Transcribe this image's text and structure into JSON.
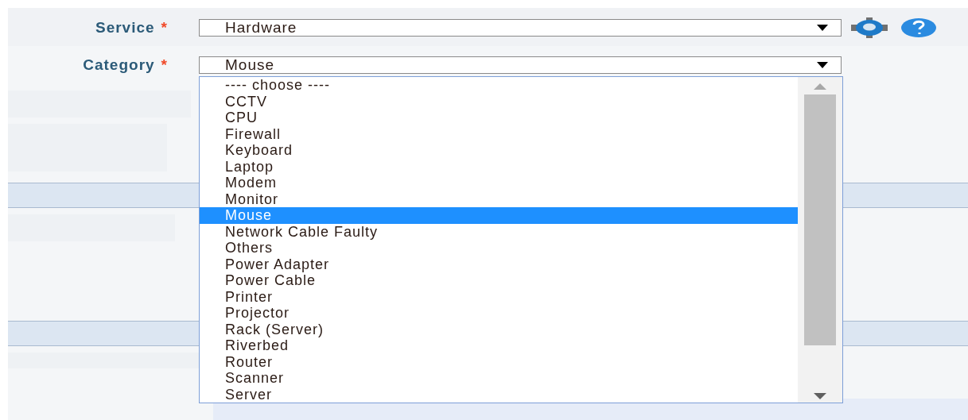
{
  "fields": [
    {
      "label": "Service",
      "required_mark": "*",
      "value": "Hardware"
    },
    {
      "label": "Category",
      "required_mark": "*",
      "value": "Mouse"
    }
  ],
  "dropdown": {
    "options": [
      {
        "label": "---- choose ----",
        "selected": false
      },
      {
        "label": "CCTV",
        "selected": false
      },
      {
        "label": "CPU",
        "selected": false
      },
      {
        "label": "Firewall",
        "selected": false
      },
      {
        "label": "Keyboard",
        "selected": false
      },
      {
        "label": "Laptop",
        "selected": false
      },
      {
        "label": "Modem",
        "selected": false
      },
      {
        "label": "Monitor",
        "selected": false
      },
      {
        "label": "Mouse",
        "selected": true
      },
      {
        "label": "Network Cable Faulty",
        "selected": false
      },
      {
        "label": "Others",
        "selected": false
      },
      {
        "label": "Power Adapter",
        "selected": false
      },
      {
        "label": "Power Cable",
        "selected": false
      },
      {
        "label": "Printer",
        "selected": false
      },
      {
        "label": "Projector",
        "selected": false
      },
      {
        "label": "Rack (Server)",
        "selected": false
      },
      {
        "label": "Riverbed",
        "selected": false
      },
      {
        "label": "Router",
        "selected": false
      },
      {
        "label": "Scanner",
        "selected": false
      },
      {
        "label": "Server",
        "selected": false
      }
    ]
  }
}
